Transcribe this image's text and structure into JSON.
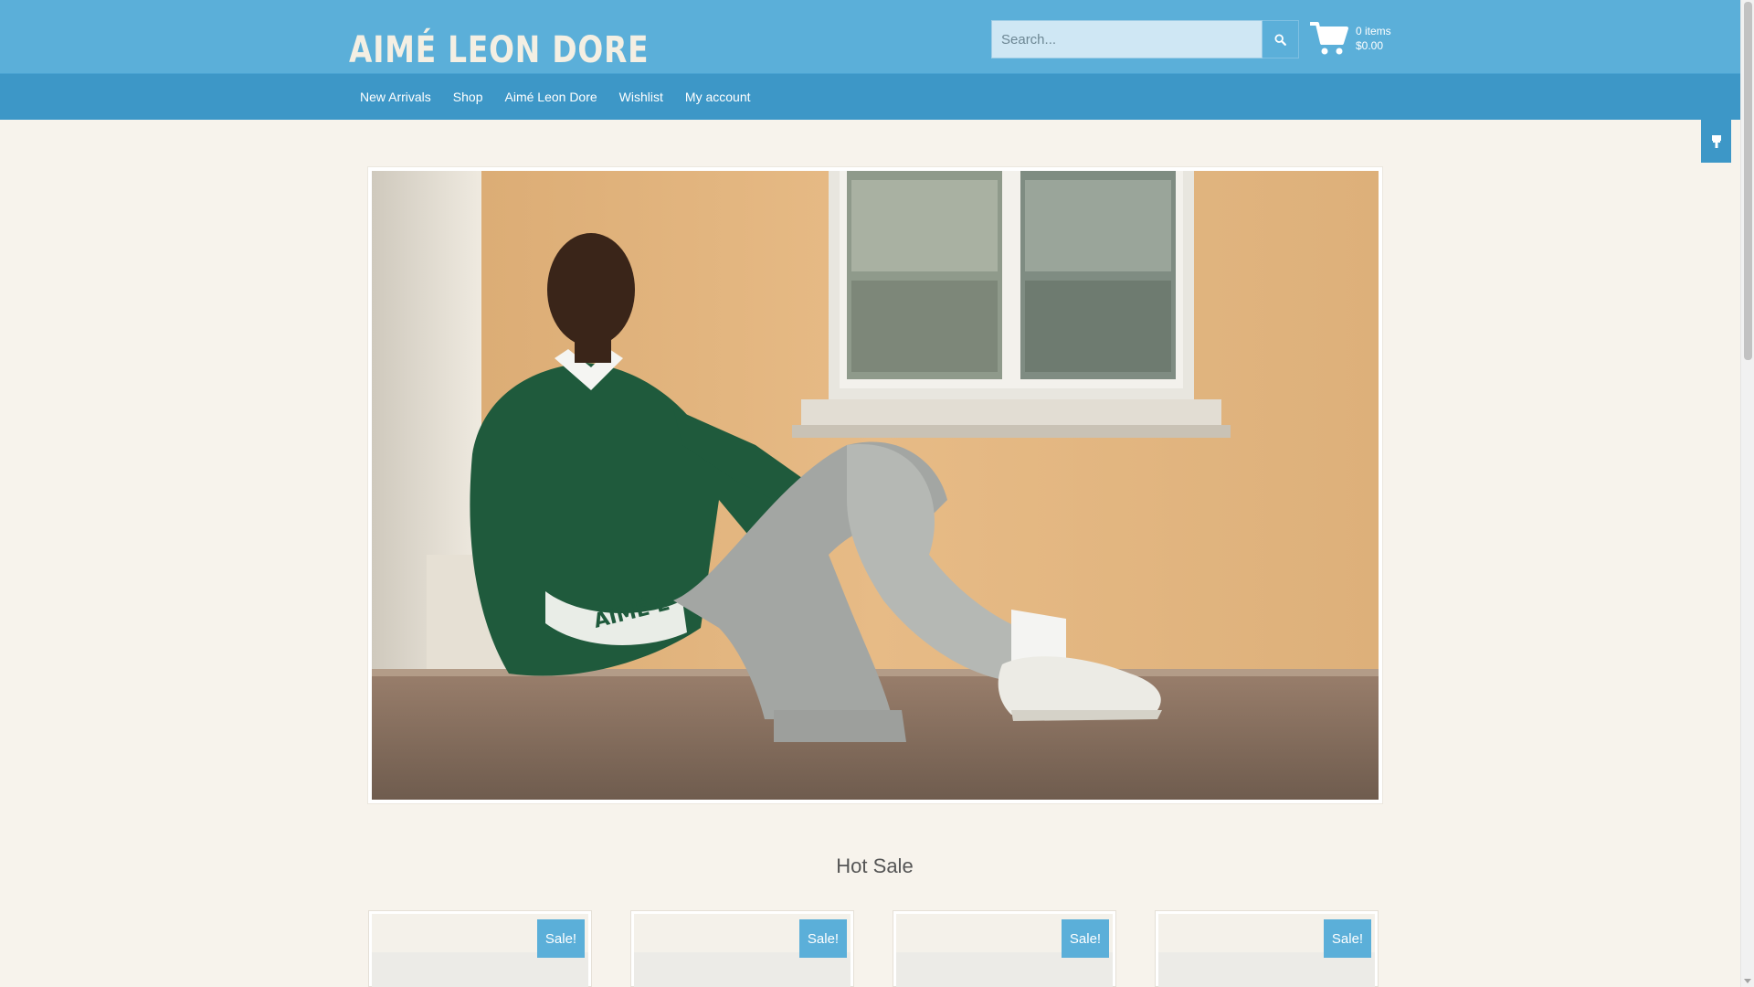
{
  "brand": {
    "logo_text": "AIMÉ LEON DORE"
  },
  "search": {
    "placeholder": "Search...",
    "icon": "search-icon"
  },
  "cart": {
    "items_text": "0 items",
    "total_text": "$0.00",
    "icon": "cart-icon"
  },
  "nav": {
    "items": [
      {
        "label": "New Arrivals"
      },
      {
        "label": "Shop"
      },
      {
        "label": "Aimé Leon Dore"
      },
      {
        "label": "Wishlist"
      },
      {
        "label": "My account"
      }
    ]
  },
  "side_tab": {
    "icon": "paintbrush-icon"
  },
  "hero": {
    "shirt_text": "AIMÉ L"
  },
  "section": {
    "title": "Hot Sale"
  },
  "products": [
    {
      "badge": "Sale!"
    },
    {
      "badge": "Sale!"
    },
    {
      "badge": "Sale!"
    },
    {
      "badge": "Sale!"
    }
  ],
  "colors": {
    "header": "#5bafd9",
    "nav": "#3d97c7",
    "page_bg": "#f7f3ec",
    "badge": "#5bafd9"
  }
}
